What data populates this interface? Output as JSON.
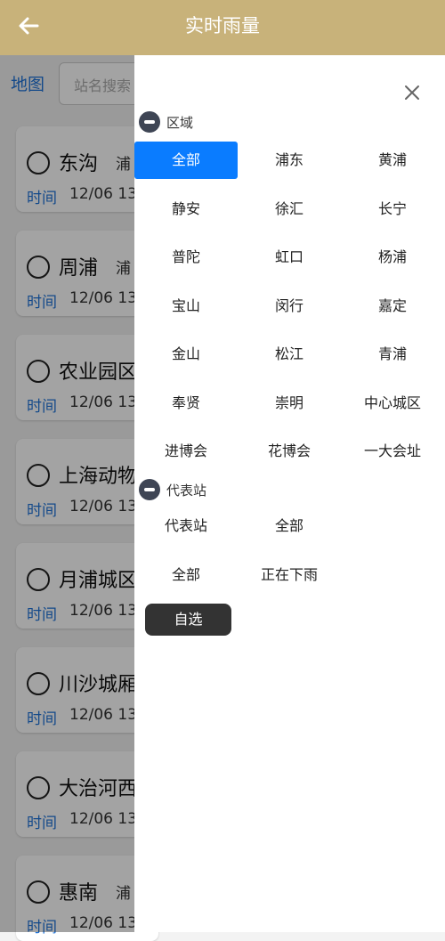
{
  "header": {
    "title": "实时雨量",
    "back_icon": "back-arrow-icon"
  },
  "background": {
    "map_label": "地图",
    "search_placeholder": "站名搜索",
    "stations": [
      {
        "name": "东沟",
        "district": "浦",
        "time_label": "时间",
        "time": "12/06 13"
      },
      {
        "name": "周浦",
        "district": "浦",
        "time_label": "时间",
        "time": "12/06 13"
      },
      {
        "name": "农业园区",
        "district": "",
        "time_label": "时间",
        "time": "12/06 13"
      },
      {
        "name": "上海动物",
        "district": "",
        "time_label": "时间",
        "time": "12/06 13"
      },
      {
        "name": "月浦城区",
        "district": "",
        "time_label": "时间",
        "time": "12/06 13"
      },
      {
        "name": "川沙城厢",
        "district": "",
        "time_label": "时间",
        "time": "12/06 13"
      },
      {
        "name": "大治河西",
        "district": "",
        "time_label": "时间",
        "time": "12/06 13"
      },
      {
        "name": "惠南",
        "district": "浦",
        "time_label": "时间",
        "time": "12/06 13"
      }
    ]
  },
  "drawer": {
    "close_icon": "close-icon",
    "region_section": {
      "title": "区域",
      "options": [
        "全部",
        "浦东",
        "黄浦",
        "静安",
        "徐汇",
        "长宁",
        "普陀",
        "虹口",
        "杨浦",
        "宝山",
        "闵行",
        "嘉定",
        "金山",
        "松江",
        "青浦",
        "奉贤",
        "崇明",
        "中心城区",
        "进博会",
        "花博会",
        "一大会址"
      ],
      "selected": "全部"
    },
    "station_section": {
      "title": "代表站",
      "options": [
        "代表站",
        "全部",
        "全部",
        "正在下雨"
      ]
    },
    "custom_button": "自选"
  },
  "colors": {
    "header": "#c8b27a",
    "accent_blue": "#0a7cff",
    "link_blue": "#1f73d8",
    "dark_button": "#333333"
  }
}
